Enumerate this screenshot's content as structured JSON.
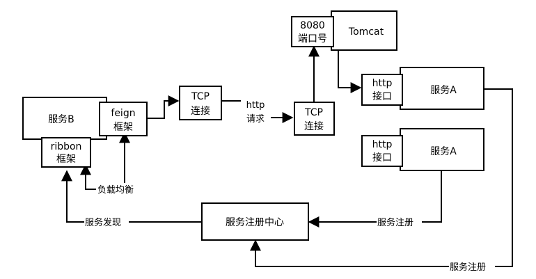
{
  "nodes": {
    "service_b": "服务B",
    "feign": [
      "feign",
      "框架"
    ],
    "ribbon": [
      "ribbon",
      "框架"
    ],
    "tcp_left": [
      "TCP",
      "连接"
    ],
    "tcp_right": [
      "TCP",
      "连接"
    ],
    "port": [
      "8080",
      "端口号"
    ],
    "tomcat": "Tomcat",
    "http_top": [
      "http",
      "接口"
    ],
    "service_a_top": "服务A",
    "http_bottom": [
      "http",
      "接口"
    ],
    "service_a_bottom": "服务A",
    "registry": "服务注册中心"
  },
  "edges": {
    "http_request": [
      "http",
      "请求"
    ],
    "load_balance": "负载均衡",
    "discovery": "服务发现",
    "register_a2": "服务注册",
    "register_a1": "服务注册"
  }
}
